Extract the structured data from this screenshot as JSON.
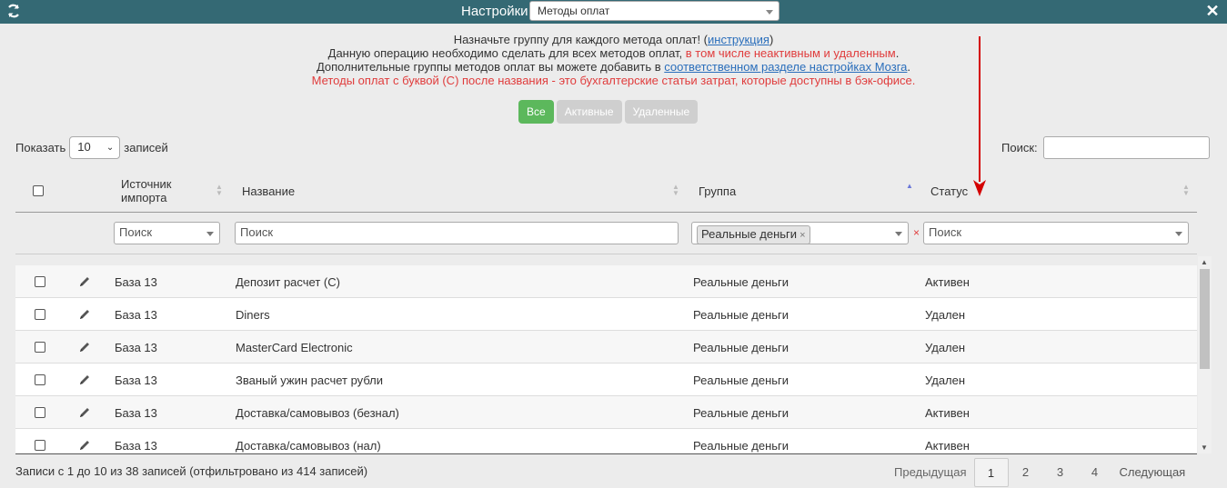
{
  "titlebar": {
    "title": "Настройки",
    "select_value": "Методы оплат",
    "refresh_icon": "refresh-icon",
    "close_icon": "close-icon"
  },
  "info": {
    "line1_pre": "Назначьте группу для каждого метода оплат! (",
    "line1_link": "инструкция",
    "line1_post": ")",
    "line2_pre": "Данную операцию необходимо сделать для всех методов оплат, ",
    "line2_red": "в том числе неактивным и удаленным",
    "line2_post": ".",
    "line3_pre": "Дополнительные группы методов оплат вы можете добавить в ",
    "line3_link": "соответственном разделе настройках Мозга",
    "line3_post": ".",
    "line4_red": "Методы оплат с буквой (С) после названия - это бухгалтерские статьи затрат, которые доступны в бэк-офисе."
  },
  "filters": {
    "all": "Все",
    "active": "Активные",
    "deleted": "Удаленные"
  },
  "length": {
    "show": "Показать",
    "value": "10",
    "entries": "записей"
  },
  "search": {
    "label": "Поиск:"
  },
  "columns": {
    "source": "Источник импорта",
    "name": "Название",
    "group": "Группа",
    "status": "Статус"
  },
  "column_filters": {
    "source_placeholder": "Поиск",
    "name_placeholder": "Поиск",
    "group_tag": "Реальные деньги",
    "status_placeholder": "Поиск"
  },
  "rows": [
    {
      "source": "База 13",
      "name": "Депозит расчет (С)",
      "group": "Реальные деньги",
      "status": "Активен"
    },
    {
      "source": "База 13",
      "name": "Diners",
      "group": "Реальные деньги",
      "status": "Удален"
    },
    {
      "source": "База 13",
      "name": "MasterCard Electronic",
      "group": "Реальные деньги",
      "status": "Удален"
    },
    {
      "source": "База 13",
      "name": "Званый ужин расчет рубли",
      "group": "Реальные деньги",
      "status": "Удален"
    },
    {
      "source": "База 13",
      "name": "Доставка/самовывоз (безнал)",
      "group": "Реальные деньги",
      "status": "Активен"
    },
    {
      "source": "База 13",
      "name": "Доставка/самовывоз (нал)",
      "group": "Реальные деньги",
      "status": "Активен"
    }
  ],
  "footer": {
    "info": "Записи с 1 до 10 из 38 записей (отфильтровано из 414 записей)",
    "prev": "Предыдущая",
    "pages": [
      "1",
      "2",
      "3",
      "4"
    ],
    "current_page": "1",
    "next": "Следующая"
  },
  "colors": {
    "titlebar": "#346974",
    "btn_active": "#5cb85c",
    "btn_inactive": "#cfcfcf",
    "link": "#2a6ebb",
    "warn": "#e03c3c",
    "annotation_arrow": "#d40000"
  }
}
